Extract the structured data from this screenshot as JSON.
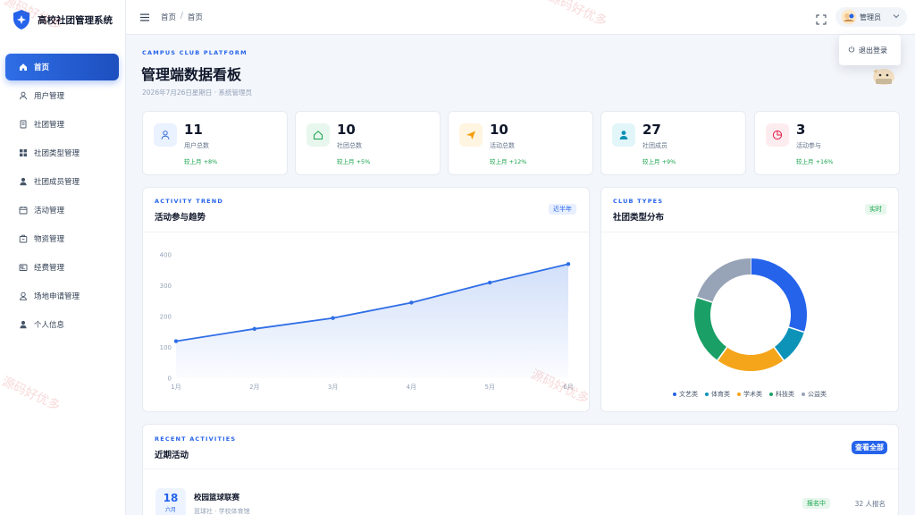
{
  "app": {
    "title": "高校社团管理系统"
  },
  "sidebar": {
    "items": [
      {
        "label": "首页",
        "icon": "home-icon",
        "active": true
      },
      {
        "label": "用户管理",
        "icon": "user-icon"
      },
      {
        "label": "社团管理",
        "icon": "document-icon"
      },
      {
        "label": "社团类型管理",
        "icon": "grid-icon"
      },
      {
        "label": "社团成员管理",
        "icon": "person-icon"
      },
      {
        "label": "活动管理",
        "icon": "calendar-icon"
      },
      {
        "label": "物资管理",
        "icon": "box-icon"
      },
      {
        "label": "经费管理",
        "icon": "wallet-icon"
      },
      {
        "label": "场地申请管理",
        "icon": "location-icon"
      },
      {
        "label": "个人信息",
        "icon": "profile-icon"
      }
    ]
  },
  "header": {
    "breadcrumb": [
      "首页",
      "首页"
    ],
    "user_name": "管理员",
    "dropdown": {
      "logout_label": "退出登录"
    }
  },
  "dashboard": {
    "eyebrow": "CAMPUS CLUB PLATFORM",
    "title": "管理端数据看板",
    "subtitle": "2026年7月26日星期日 · 系统管理员"
  },
  "stats": [
    {
      "value": "11",
      "label": "用户总数",
      "trend": "较上月 +8%",
      "icon": "user-icon",
      "color": "#3b6fd9",
      "bg": "#eaf1ff"
    },
    {
      "value": "10",
      "label": "社团总数",
      "trend": "较上月 +5%",
      "icon": "home-outline-icon",
      "color": "#16a34a",
      "bg": "#e8f7ee"
    },
    {
      "value": "10",
      "label": "活动总数",
      "trend": "较上月 +12%",
      "icon": "paper-plane-icon",
      "color": "#f59e0b",
      "bg": "#fff5e0"
    },
    {
      "value": "27",
      "label": "社团成员",
      "trend": "较上月 +9%",
      "icon": "member-icon",
      "color": "#0891b2",
      "bg": "#e2f6fa"
    },
    {
      "value": "3",
      "label": "活动参与",
      "trend": "较上月 +16%",
      "icon": "pie-icon",
      "color": "#e11d48",
      "bg": "#fdecef"
    }
  ],
  "activity_panel": {
    "eyebrow": "ACTIVITY TREND",
    "title": "活动参与趋势",
    "tag": "近半年"
  },
  "club_panel": {
    "eyebrow": "CLUB TYPES",
    "title": "社团类型分布",
    "tag": "实时"
  },
  "recent": {
    "eyebrow": "RECENT ACTIVITIES",
    "title": "近期活动",
    "view_all": "查看全部",
    "items": [
      {
        "day": "18",
        "month": "六月",
        "title": "校园篮球联赛",
        "sub": "篮球社 · 学校体育馆",
        "status": "报名中",
        "count": "32 人报名"
      }
    ]
  },
  "watermark": "源码好优多",
  "chart_data": [
    {
      "type": "area",
      "categories": [
        "1月",
        "2月",
        "3月",
        "4月",
        "5月",
        "6月"
      ],
      "series": [
        {
          "values": [
            120,
            160,
            195,
            245,
            310,
            370
          ]
        }
      ],
      "ylim": [
        0,
        400
      ],
      "yticks": [
        0,
        100,
        200,
        300,
        400
      ],
      "grid": false,
      "color": "#2f6ee6"
    },
    {
      "type": "pie",
      "categories": [
        "文艺类",
        "体育类",
        "学术类",
        "科技类",
        "公益类"
      ],
      "values": [
        30,
        10,
        20,
        20,
        20
      ],
      "colors": [
        "#2563eb",
        "#0e93b8",
        "#f5a51a",
        "#1aa067",
        "#97a3b6"
      ],
      "legend": "bottom"
    }
  ]
}
